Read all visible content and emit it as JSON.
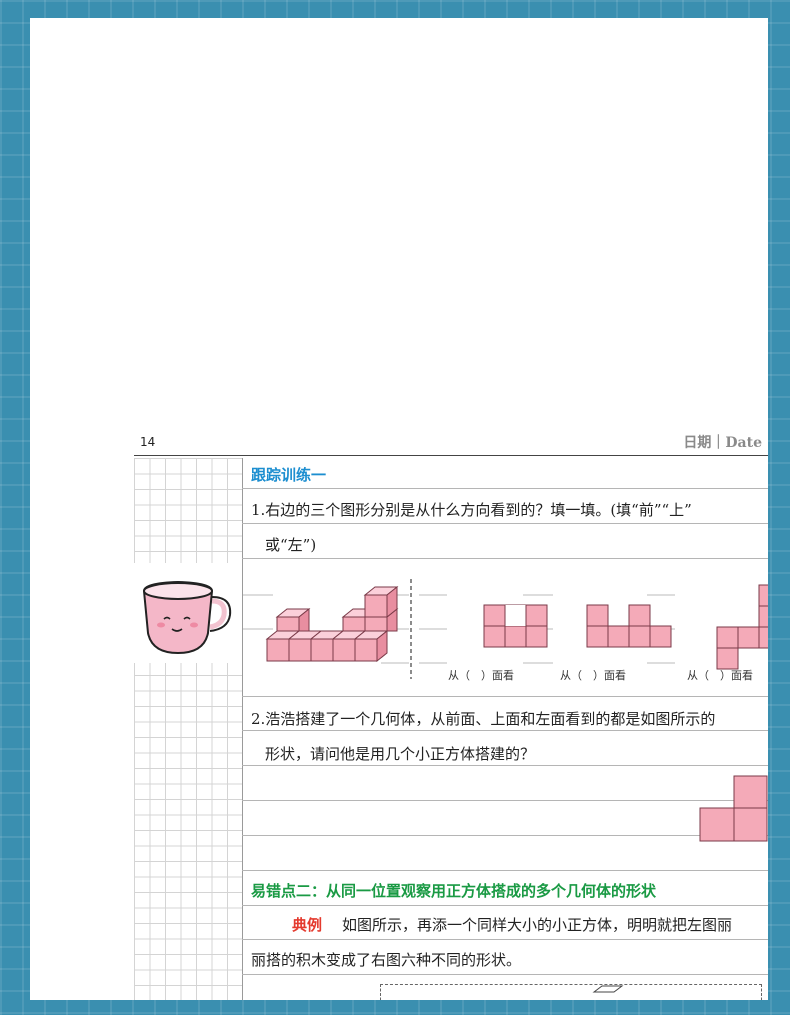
{
  "page": {
    "page_number": "14",
    "date_label": "日期｜Date"
  },
  "section": {
    "title": "跟踪训练一"
  },
  "q1": {
    "line1": "1.右边的三个图形分别是从什么方向看到的？填一填。(填“前”“上”",
    "line2": "或“左”)",
    "captions": [
      "从（　）面看",
      "从（　）面看",
      "从（　）面看"
    ]
  },
  "q2": {
    "line1": "2.浩浩搭建了一个几何体，从前面、上面和左面看到的都是如图所示的",
    "line2": "形状，请问他是用几个小正方体搭建的？"
  },
  "err": {
    "title": "易错点二：从同一位置观察用正方体搭成的多个几何体的形状",
    "example_label": "典例",
    "example_line1": "如图所示，再添一个同样大小的小正方体，明明就把左图丽",
    "example_line2": "丽搭的积木变成了右图六种不同的形状。"
  },
  "colors": {
    "frame": "#3a8fb0",
    "section_blue": "#1c8ed0",
    "error_green": "#1a9a44",
    "example_red": "#e43a2e",
    "cube_pink": "#f4aab8"
  },
  "icons": [
    "cup-illustration",
    "cube-stack-3d",
    "view-grid-front",
    "view-grid-top",
    "view-grid-left",
    "view-grid-q2"
  ]
}
